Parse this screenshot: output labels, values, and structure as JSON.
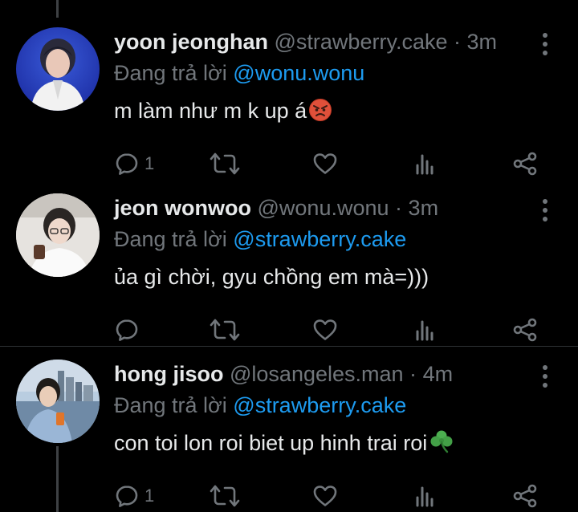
{
  "colors": {
    "background": "#000000",
    "text": "#e7e9ea",
    "muted": "#71767b",
    "mention": "#1d9bf0",
    "thread_line": "#3e4144",
    "divider": "#2f3336"
  },
  "tweets": [
    {
      "name": "yoon jeonghan",
      "handle": "@strawberry.cake",
      "separator": "·",
      "time": "3m",
      "replying_prefix": "Đang trả lời",
      "replying_to": "@wonu.wonu",
      "text": "m làm như m k up á",
      "emoji": "angry-face-icon",
      "reply_count": "1",
      "actions": [
        "reply-icon",
        "retweet-icon",
        "like-icon",
        "views-icon",
        "share-icon"
      ]
    },
    {
      "name": "jeon wonwoo",
      "handle": "@wonu.wonu",
      "separator": "·",
      "time": "3m",
      "replying_prefix": "Đang trả lời",
      "replying_to": "@strawberry.cake",
      "text": "ủa gì chời, gyu chồng em mà=)))",
      "reply_count": "",
      "actions": [
        "reply-icon",
        "retweet-icon",
        "like-icon",
        "views-icon",
        "share-icon"
      ]
    },
    {
      "name": "hong jisoo",
      "handle": "@losangeles.man",
      "separator": "·",
      "time": "4m",
      "replying_prefix": "Đang trả lời",
      "replying_to": "@strawberry.cake",
      "text": "con toi lon roi biet up hinh trai roi",
      "emoji": "shamrock-icon",
      "reply_count": "1",
      "actions": [
        "reply-icon",
        "retweet-icon",
        "like-icon",
        "views-icon",
        "share-icon"
      ]
    }
  ]
}
